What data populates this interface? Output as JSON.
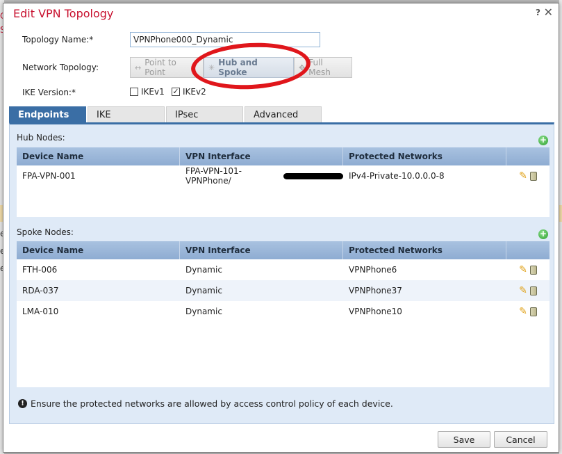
{
  "background": {
    "left_letters": [
      "C",
      "S"
    ],
    "left_letters_dark": [
      "e",
      "e",
      "e"
    ]
  },
  "dialog": {
    "title": "Edit VPN Topology",
    "help_label": "?",
    "close_label": "✕"
  },
  "form": {
    "topology_name_label": "Topology Name:*",
    "topology_name_value": "VPNPhone000_Dynamic",
    "network_topology_label": "Network Topology:",
    "topology_options": [
      {
        "label": "Point to Point",
        "icon": "↔",
        "active": false
      },
      {
        "label": "Hub and Spoke",
        "icon": "✳",
        "active": true
      },
      {
        "label": "Full Mesh",
        "icon": "✥",
        "active": false
      }
    ],
    "ike_version_label": "IKE Version:*",
    "ikev1_label": "IKEv1",
    "ikev1_checked": false,
    "ikev2_label": "IKEv2",
    "ikev2_checked": true
  },
  "tabs": [
    "Endpoints",
    "IKE",
    "IPsec",
    "Advanced"
  ],
  "hub": {
    "label": "Hub Nodes:",
    "columns": [
      "Device Name",
      "VPN Interface",
      "Protected Networks"
    ],
    "rows": [
      {
        "device": "FPA-VPN-001",
        "interface": "FPA-VPN-101-VPNPhone/",
        "networks": "IPv4-Private-10.0.0.0-8"
      }
    ]
  },
  "spoke": {
    "label": "Spoke Nodes:",
    "columns": [
      "Device Name",
      "VPN Interface",
      "Protected Networks"
    ],
    "rows": [
      {
        "device": "FTH-006",
        "interface": "Dynamic",
        "networks": "VPNPhone6"
      },
      {
        "device": "RDA-037",
        "interface": "Dynamic",
        "networks": "VPNPhone37"
      },
      {
        "device": "LMA-010",
        "interface": "Dynamic",
        "networks": "VPNPhone10"
      }
    ]
  },
  "info_text": "Ensure the protected networks are allowed by access control policy of each device.",
  "buttons": {
    "save": "Save",
    "cancel": "Cancel"
  },
  "colors": {
    "title": "#c8102e",
    "tab_active": "#3a6ea5",
    "panel": "#dfeaf7",
    "highlight_ring": "#e0161b"
  }
}
